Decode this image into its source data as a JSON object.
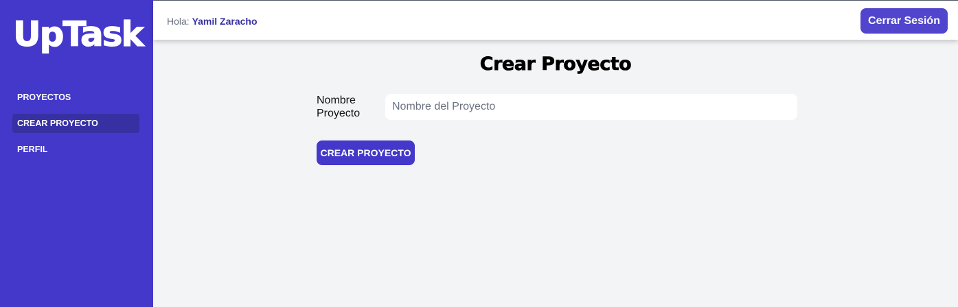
{
  "app": {
    "logo": "UpTask"
  },
  "sidebar": {
    "items": [
      {
        "label": "PROYECTOS",
        "active": false
      },
      {
        "label": "CREAR PROYECTO",
        "active": true
      },
      {
        "label": "PERFIL",
        "active": false
      }
    ]
  },
  "header": {
    "greeting_prefix": "Hola:",
    "user_name": "Yamil Zaracho",
    "logout_label": "Cerrar Sesión"
  },
  "main": {
    "title": "Crear Proyecto",
    "form": {
      "name_label": "Nombre Proyecto",
      "name_value": "",
      "name_placeholder": "Nombre del Proyecto",
      "submit_label": "CREAR PROYECTO"
    }
  },
  "colors": {
    "sidebar_bg": "#4338ca",
    "sidebar_active_bg": "#3730a3",
    "accent": "#5145cd",
    "page_bg": "#f3f4f6"
  }
}
